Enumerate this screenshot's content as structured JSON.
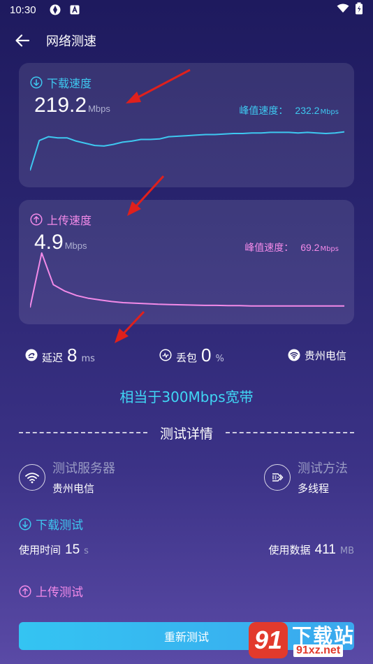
{
  "status_bar": {
    "time": "10:30"
  },
  "app_bar": {
    "title": "网络测速"
  },
  "download": {
    "heading": "下载速度",
    "speed": "219.2",
    "unit": "Mbps",
    "peak_label": "峰值速度：",
    "peak_value": "232.2",
    "peak_unit": "Mbps",
    "color": "#3ec8f0",
    "graph": [
      0,
      0.55,
      0.62,
      0.6,
      0.6,
      0.54,
      0.5,
      0.46,
      0.45,
      0.48,
      0.52,
      0.54,
      0.57,
      0.57,
      0.58,
      0.62,
      0.63,
      0.64,
      0.65,
      0.66,
      0.66,
      0.67,
      0.68,
      0.68,
      0.69,
      0.69,
      0.7,
      0.7,
      0.7,
      0.69,
      0.7,
      0.69,
      0.68,
      0.69,
      0.71
    ]
  },
  "upload": {
    "heading": "上传速度",
    "speed": "4.9",
    "unit": "Mbps",
    "peak_label": "峰值速度：",
    "peak_value": "69.2",
    "peak_unit": "Mbps",
    "color": "#f28ae8",
    "graph": [
      0,
      1.0,
      0.42,
      0.3,
      0.22,
      0.17,
      0.14,
      0.11,
      0.09,
      0.08,
      0.07,
      0.06,
      0.055,
      0.05,
      0.045,
      0.04,
      0.04,
      0.035,
      0.035,
      0.03,
      0.03,
      0.03,
      0.03,
      0.03,
      0.03,
      0.03,
      0.03,
      0.03
    ]
  },
  "stats": {
    "latency_label": "延迟",
    "latency_value": "8",
    "latency_unit": "ms",
    "loss_label": "丢包",
    "loss_value": "0",
    "loss_unit": "%",
    "isp": "贵州电信"
  },
  "equivalent": "相当于300Mbps宽带",
  "details": {
    "title": "测试详情",
    "server_label": "测试服务器",
    "server_value": "贵州电信",
    "method_label": "测试方法",
    "method_value": "多线程"
  },
  "download_test": {
    "heading": "下载测试",
    "time_label": "使用时间",
    "time_value": "15",
    "time_unit": "s",
    "data_label": "使用数据",
    "data_value": "411",
    "data_unit": "MB"
  },
  "upload_test": {
    "heading": "上传测试"
  },
  "retest_button": "重新测试",
  "watermark": {
    "num": "91",
    "text": "下载站",
    "url": "91xz.net"
  },
  "icons": {
    "back": "arrow-left-icon",
    "download": "arrow-down-circle-icon",
    "upload": "arrow-up-circle-icon",
    "latency": "latency-gauge-icon",
    "loss": "packet-loss-icon",
    "wifi": "wifi-icon"
  }
}
